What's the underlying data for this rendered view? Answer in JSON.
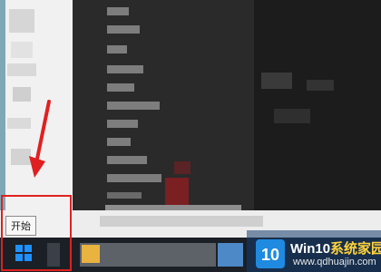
{
  "tooltip": {
    "start_label": "开始"
  },
  "watermark": {
    "logo_text": "10",
    "brand_main": "Win10",
    "brand_sub": "系统家园",
    "url": "www.qdhuajin.com"
  },
  "colors": {
    "annotation_red": "#e02020",
    "taskbar_bg": "#1b1f26",
    "start_menu_bg": "#2a2a2b",
    "windows_logo_blue": "#1e90ff"
  },
  "icons": {
    "start_button": "windows-logo-icon",
    "arrow": "red-arrow-annotation"
  }
}
